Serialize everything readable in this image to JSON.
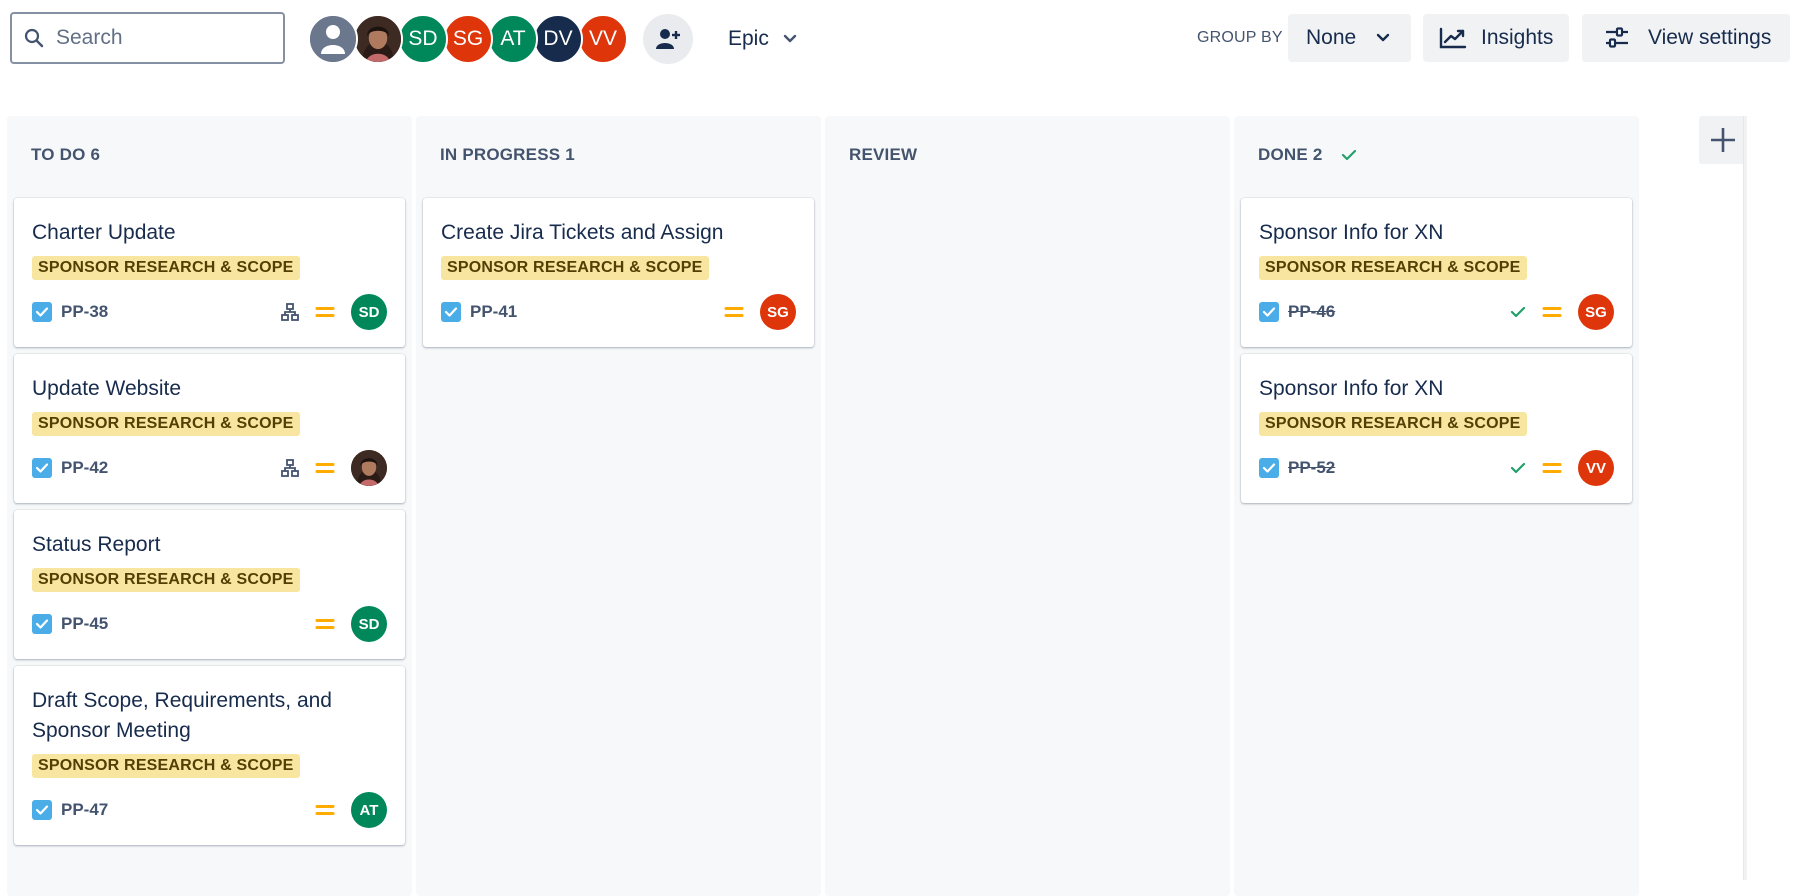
{
  "toolbar": {
    "search_placeholder": "Search",
    "avatars": [
      {
        "initials": "",
        "color": "#6b778c",
        "kind": "unassigned"
      },
      {
        "initials": "",
        "color": "#7a4a3a",
        "kind": "photo"
      },
      {
        "initials": "SD",
        "color": "#00875a"
      },
      {
        "initials": "SG",
        "color": "#de350b"
      },
      {
        "initials": "AT",
        "color": "#00875a"
      },
      {
        "initials": "DV",
        "color": "#172b4d"
      },
      {
        "initials": "VV",
        "color": "#de350b"
      }
    ],
    "epic_label": "Epic",
    "group_by_label": "GROUP BY",
    "group_by_value": "None",
    "insights_label": "Insights",
    "view_settings_label": "View settings"
  },
  "columns": [
    {
      "name": "TO DO",
      "count": "6",
      "done_mark": false,
      "cards": [
        {
          "title": "Charter Update",
          "epic": "SPONSOR RESEARCH & SCOPE",
          "key": "PP-38",
          "done": false,
          "has_child": true,
          "assignee": {
            "initials": "SD",
            "color": "#00875a"
          }
        },
        {
          "title": "Update Website",
          "epic": "SPONSOR RESEARCH & SCOPE",
          "key": "PP-42",
          "done": false,
          "has_child": true,
          "assignee": {
            "initials": "",
            "color": "#7a4a3a",
            "photo": true
          }
        },
        {
          "title": "Status Report",
          "epic": "SPONSOR RESEARCH & SCOPE",
          "key": "PP-45",
          "done": false,
          "has_child": false,
          "assignee": {
            "initials": "SD",
            "color": "#00875a"
          }
        },
        {
          "title": "Draft Scope, Requirements, and Sponsor Meeting",
          "epic": "SPONSOR RESEARCH & SCOPE",
          "key": "PP-47",
          "done": false,
          "has_child": false,
          "assignee": {
            "initials": "AT",
            "color": "#00875a"
          }
        }
      ]
    },
    {
      "name": "IN PROGRESS",
      "count": "1",
      "done_mark": false,
      "cards": [
        {
          "title": "Create Jira Tickets and Assign",
          "epic": "SPONSOR RESEARCH & SCOPE",
          "key": "PP-41",
          "done": false,
          "has_child": false,
          "assignee": {
            "initials": "SG",
            "color": "#de350b"
          }
        }
      ]
    },
    {
      "name": "REVIEW",
      "count": "",
      "done_mark": false,
      "cards": []
    },
    {
      "name": "DONE",
      "count": "2",
      "done_mark": true,
      "cards": [
        {
          "title": "Sponsor Info for XN",
          "epic": "SPONSOR RESEARCH & SCOPE",
          "key": "PP-46",
          "done": true,
          "has_child": false,
          "assignee": {
            "initials": "SG",
            "color": "#de350b"
          }
        },
        {
          "title": "Sponsor Info for XN",
          "epic": "SPONSOR RESEARCH & SCOPE",
          "key": "PP-52",
          "done": true,
          "has_child": false,
          "assignee": {
            "initials": "VV",
            "color": "#de350b"
          }
        }
      ]
    }
  ],
  "colors": {
    "priority": "#ffab00",
    "done_check": "#22a06b",
    "task_icon": "#4bade8",
    "epic_bg": "#f8e6a0",
    "epic_text": "#533f04"
  }
}
